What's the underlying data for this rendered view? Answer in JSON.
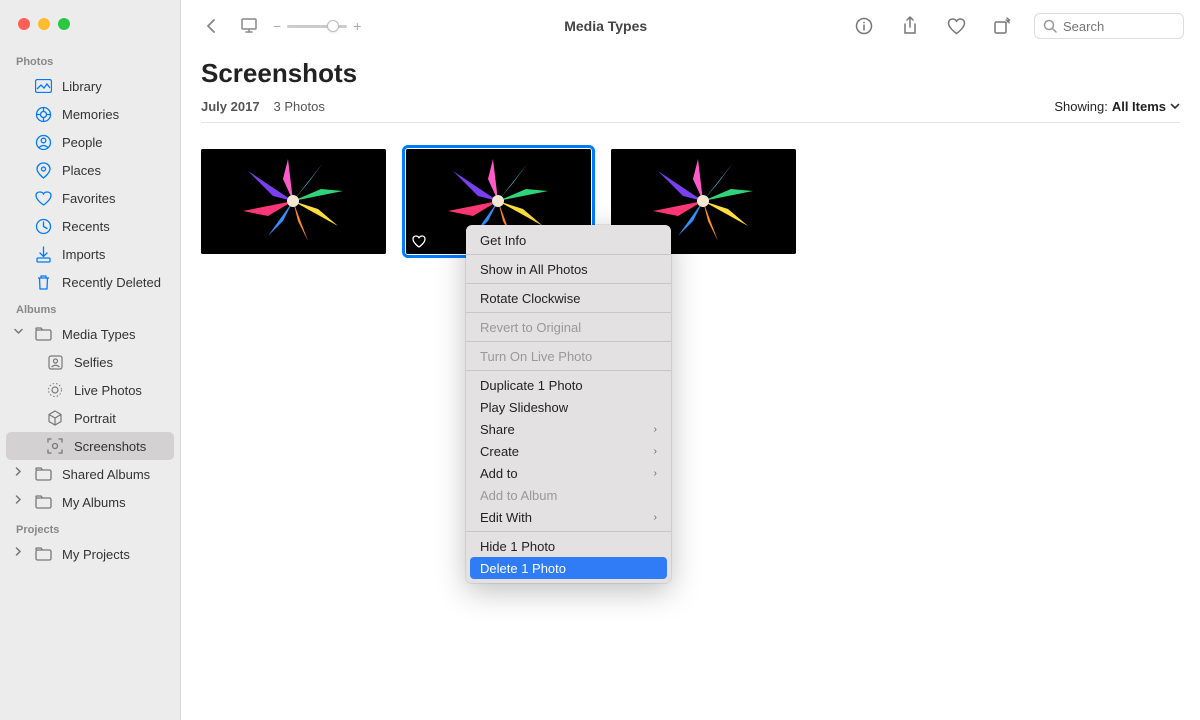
{
  "header": {
    "title": "Media Types"
  },
  "search": {
    "placeholder": "Search"
  },
  "page": {
    "title": "Screenshots",
    "date": "July 2017",
    "count": "3 Photos",
    "showing_label": "Showing:",
    "showing_value": "All Items"
  },
  "sidebar": {
    "photos_label": "Photos",
    "albums_label": "Albums",
    "projects_label": "Projects",
    "photos": [
      {
        "label": "Library"
      },
      {
        "label": "Memories"
      },
      {
        "label": "People"
      },
      {
        "label": "Places"
      },
      {
        "label": "Favorites"
      },
      {
        "label": "Recents"
      },
      {
        "label": "Imports"
      },
      {
        "label": "Recently Deleted"
      }
    ],
    "albums": [
      {
        "label": "Media Types"
      },
      {
        "label": "Selfies"
      },
      {
        "label": "Live Photos"
      },
      {
        "label": "Portrait"
      },
      {
        "label": "Screenshots"
      },
      {
        "label": "Shared Albums"
      },
      {
        "label": "My Albums"
      }
    ],
    "projects": [
      {
        "label": "My Projects"
      }
    ]
  },
  "context_menu": {
    "items": [
      {
        "label": "Get Info"
      },
      {
        "label": "Show in All Photos"
      },
      {
        "label": "Rotate Clockwise"
      },
      {
        "label": "Revert to Original"
      },
      {
        "label": "Turn On Live Photo"
      },
      {
        "label": "Duplicate 1 Photo"
      },
      {
        "label": "Play Slideshow"
      },
      {
        "label": "Share"
      },
      {
        "label": "Create"
      },
      {
        "label": "Add to"
      },
      {
        "label": "Add to Album"
      },
      {
        "label": "Edit With"
      },
      {
        "label": "Hide 1 Photo"
      },
      {
        "label": "Delete 1 Photo"
      }
    ]
  }
}
